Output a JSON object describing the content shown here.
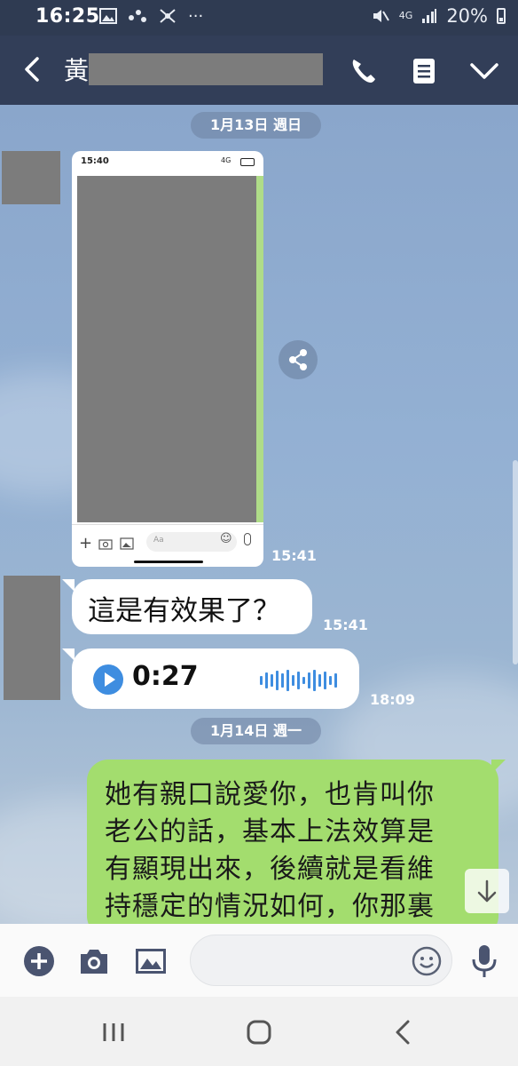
{
  "status_bar": {
    "time": "16:25",
    "left_icons": [
      "image-icon",
      "dots-icon",
      "network-icon",
      "more-icon"
    ],
    "more_text": "···",
    "network": "4G",
    "battery": "20%"
  },
  "header": {
    "contact_name": "黃",
    "icons": [
      "back-icon",
      "phone-icon",
      "notes-icon",
      "chevron-down-icon"
    ]
  },
  "chat": {
    "date1": "1月13日 週日",
    "date2": "1月14日 週一",
    "image_message": {
      "status_time": "15:40",
      "status_right": "4G",
      "input_placeholder": "Aa",
      "time": "15:41"
    },
    "text_message": {
      "text": "這是有效果了？",
      "time": "15:41"
    },
    "voice_message": {
      "duration": "0:27",
      "time": "18:09"
    },
    "sent_message": {
      "lines": [
        "她有親口說愛你，也肯叫你",
        "老公的話，基本上法效算是",
        "有顯現出來，後續就是看維",
        "持穩定的情況如何，你那裏"
      ]
    }
  },
  "input_bar": {
    "icons": [
      "plus-icon",
      "camera-icon",
      "image-icon",
      "emoji-icon",
      "mic-icon"
    ]
  },
  "colors": {
    "header_bg": "#323e58",
    "sent_bubble": "#a3dd6e",
    "accent": "#3e8de0",
    "chat_bg": "#8ea8c8"
  }
}
